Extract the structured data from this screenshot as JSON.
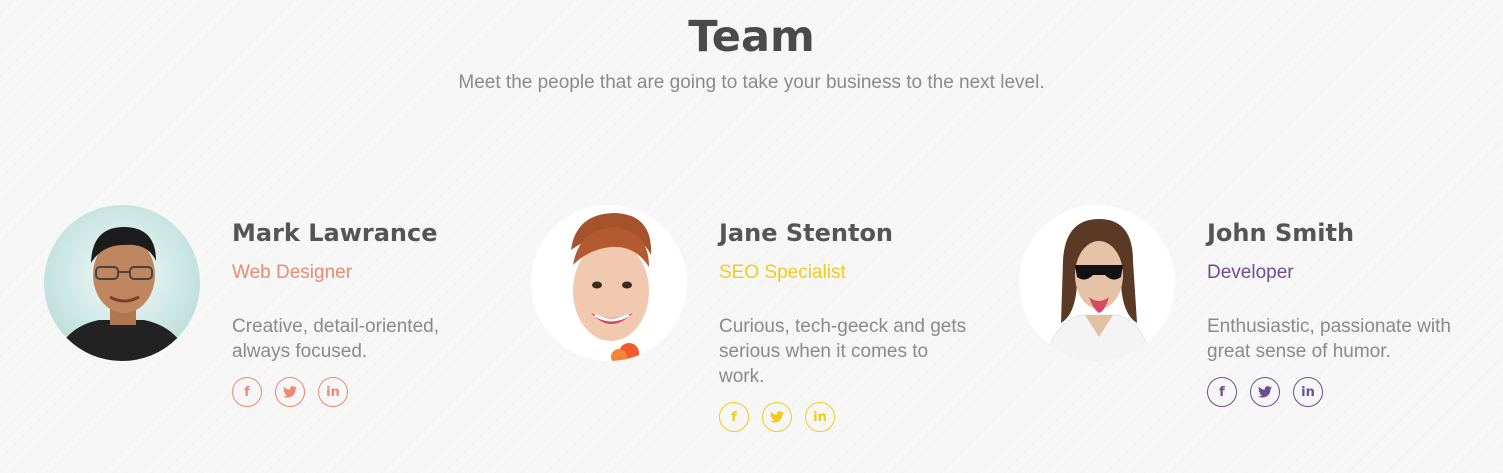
{
  "header": {
    "title": "Team",
    "subtitle": "Meet the people that are going to take your business to the next level."
  },
  "members": [
    {
      "name": "Mark Lawrance",
      "role": "Web Designer",
      "bio": "Creative, detail-oriented, always focused.",
      "accent": "#e98a72",
      "socials": [
        "facebook-icon",
        "twitter-icon",
        "linkedin-icon"
      ]
    },
    {
      "name": "Jane Stenton",
      "role": "SEO Specialist",
      "bio": "Curious, tech-geeck and gets serious when it comes to work.",
      "accent": "#f1cb1e",
      "socials": [
        "facebook-icon",
        "twitter-icon",
        "linkedin-icon"
      ]
    },
    {
      "name": "John Smith",
      "role": "Developer",
      "bio": "Enthusiastic, passionate with great sense of humor.",
      "accent": "#6b4f92",
      "socials": [
        "facebook-icon",
        "twitter-icon",
        "linkedin-icon"
      ]
    }
  ],
  "social_labels": {
    "facebook": "f",
    "linkedin": "in"
  }
}
